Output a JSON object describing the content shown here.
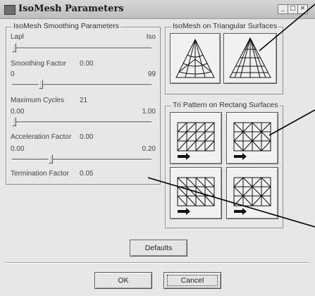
{
  "window": {
    "title": "IsoMesh Parameters"
  },
  "titlebar_buttons": {
    "minimize": "_",
    "restore": "□",
    "close": "×"
  },
  "smoothing": {
    "title": "IsoMesh Smoothing Parameters",
    "lapl_label": "Lapl",
    "iso_label": "Iso",
    "lapl_iso_position": 0.0,
    "smoothing_factor": {
      "label": "Smoothing Factor",
      "value": "0.00",
      "min": "0",
      "max": "99",
      "position": 0.2
    },
    "maximum_cycles": {
      "label": "Maximum Cycles",
      "value": "21",
      "min": "0.00",
      "max": "1.00",
      "position": 0.0
    },
    "acceleration_factor": {
      "label": "Acceleration Factor",
      "value": "0.00",
      "min": "0.00",
      "max": "0.20",
      "position": 0.27
    },
    "termination_factor": {
      "label": "Termination Factor",
      "value": "0.05"
    }
  },
  "tri_surfaces": {
    "title": "IsoMesh on Triangular Surfaces"
  },
  "rect_surfaces": {
    "title": "Tri Pattern on Rectang Surfaces"
  },
  "buttons": {
    "defaults": "Defaults",
    "ok": "OK",
    "cancel": "Cancel"
  }
}
